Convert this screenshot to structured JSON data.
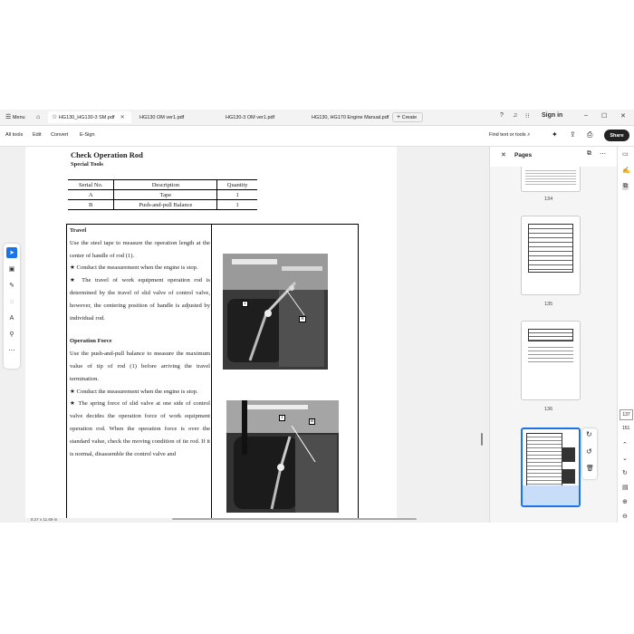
{
  "tabs": {
    "menu": "Menu",
    "items": [
      {
        "label": "HG130_HG130-3 SM.pdf"
      },
      {
        "label": "HG130 OM ver1.pdf"
      },
      {
        "label": "HG130-3 OM ver1.pdf"
      },
      {
        "label": "HG130, HG170 Engine Manual.pdf"
      }
    ],
    "create": "Create"
  },
  "account": {
    "signin": "Sign in"
  },
  "toolbar": {
    "all_tools": "All tools",
    "edit": "Edit",
    "convert": "Convert",
    "esign": "E-Sign",
    "find": "Find text or tools",
    "share": "Share"
  },
  "document": {
    "title": "Check Operation Rod",
    "subtitle": "Special Tools",
    "table": {
      "headers": [
        "Serial No.",
        "Description",
        "Quantity"
      ],
      "rows": [
        [
          "A",
          "Tape",
          "1"
        ],
        [
          "B",
          "Push-and-pull Balance",
          "1"
        ]
      ]
    },
    "travel_heading": "Travel",
    "travel_text": "Use the steel tape to measure the operation length at the center of handle of rod (1).",
    "travel_note1": "★ Conduct the measurement when the engine is stop.",
    "travel_note2": "★ The travel of work equipment operation rod is determined by the travel of slid valve of control valve, however, the centering position of handle is adjusted by individual rod.",
    "force_heading": "Operation Force",
    "force_text": "Use the push-and-pull balance to measure the maximum value of tip of rod (1) before arriving the travel termination.",
    "force_note1": "★ Conduct the measurement when the engine is stop.",
    "force_note2": "★ The spring force of slid valve at one side of control valve decides the operation force of work equipment operation rod. When the operation force is over the standard value, check the moving condition of tie rod. If it is normal, disassemble the control valve and",
    "photo1_labels": [
      "1",
      "A"
    ],
    "photo2_labels": [
      "1",
      "B"
    ]
  },
  "status": {
    "page_size": "8.27 x 11.69 in"
  },
  "pages_panel": {
    "title": "Pages",
    "page_numbers": [
      "134",
      "135",
      "136"
    ],
    "current_page": "137",
    "total_pages": "151"
  },
  "colors": {
    "accent": "#1a73e8",
    "share_bg": "#222222"
  }
}
